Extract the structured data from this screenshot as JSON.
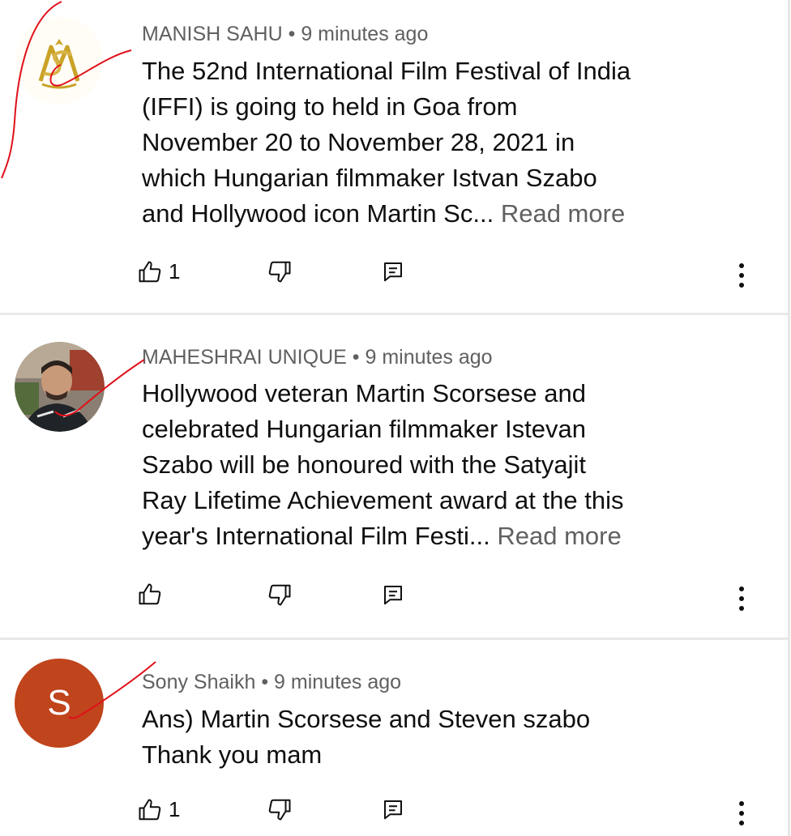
{
  "comments": [
    {
      "author": "MANISH SAHU",
      "time": "9 minutes ago",
      "lines": [
        "The 52nd International Film Festival of India",
        "(IFFI) is going to held in Goa from",
        "November 20 to November 28, 2021 in",
        "which Hungarian filmmaker Istvan Szabo",
        "and Hollywood icon Martin Sc..."
      ],
      "read_more": "Read more",
      "likes": "1",
      "avatar_icon": "ms-monogram-logo"
    },
    {
      "author": "MAHESHRAI UNIQUE",
      "time": "9 minutes ago",
      "lines": [
        "Hollywood veteran Martin Scorsese and",
        "celebrated Hungarian filmmaker Istevan",
        "Szabo will be honoured with the Satyajit",
        "Ray Lifetime Achievement award at the this",
        "year's International Film Festi..."
      ],
      "read_more": "Read more",
      "likes": "",
      "avatar_icon": "profile-photo"
    },
    {
      "author": "Sony Shaikh",
      "time": "9 minutes ago",
      "lines": [
        "Ans) Martin Scorsese and Steven szabo",
        "Thank you mam"
      ],
      "read_more": "",
      "likes": "1",
      "avatar_letter": "S",
      "avatar_color": "#c0441c"
    }
  ],
  "separator": "•",
  "colors": {
    "meta": "#606060",
    "text": "#0f0f0f",
    "annotation": "#e0101a",
    "logo_gold": "#c9a227"
  },
  "icons": [
    "thumb-up-icon",
    "thumb-down-icon",
    "reply-icon",
    "more-vert-icon"
  ]
}
